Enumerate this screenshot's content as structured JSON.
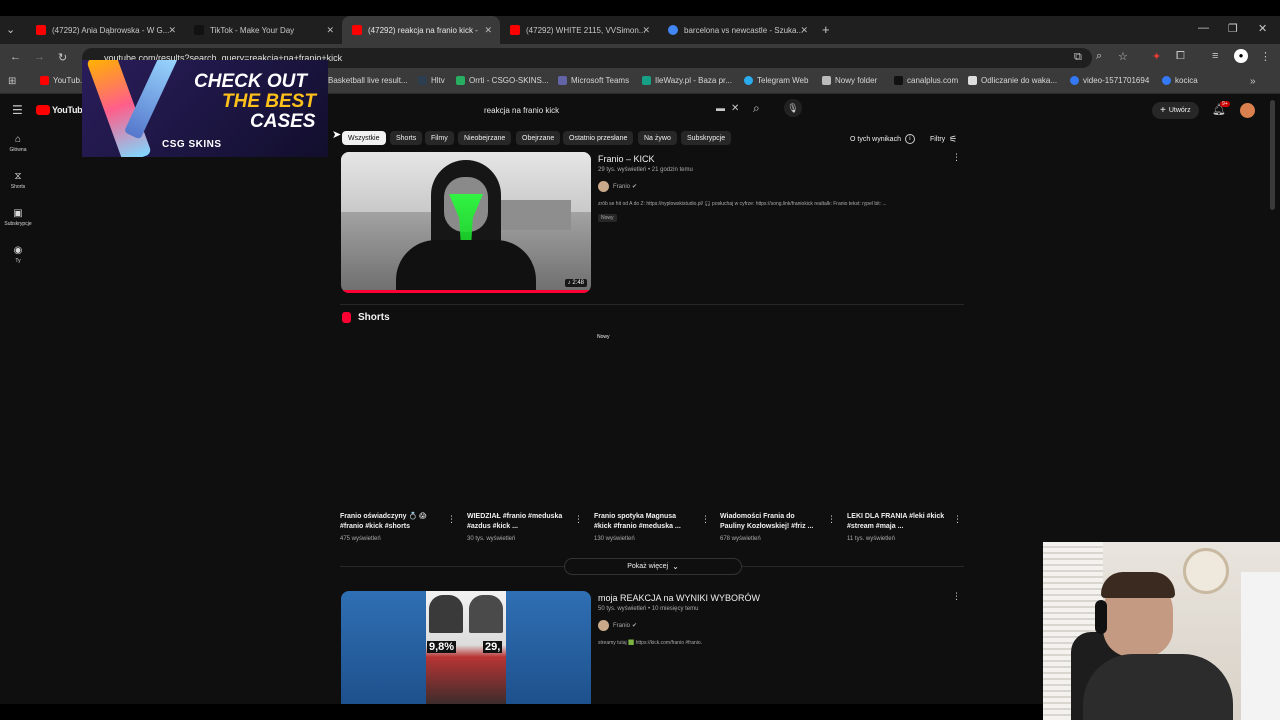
{
  "tabs": [
    {
      "label": "(47292) Ania Dąbrowska - W G...",
      "color": "#ff0000"
    },
    {
      "label": "TikTok - Make Your Day",
      "color": "#111111"
    },
    {
      "label": "(47292) reakcja na franio kick -",
      "color": "#ff0000"
    },
    {
      "label": "(47292) WHITE 2115, VVSimon...",
      "color": "#ff0000"
    },
    {
      "label": "barcelona vs newcastle - Szuka...",
      "color": "#4285f4"
    }
  ],
  "address": "youtube.com/results?search_query=reakcja+na+franio+kick",
  "bookmarks": [
    {
      "label": "YouTub...",
      "color": "#ff0000"
    },
    {
      "label": "Basketball live result...",
      "color": "#e67e22"
    },
    {
      "label": "Hltv",
      "color": "#2c3e50"
    },
    {
      "label": "Orrti - CSGO-SKINS...",
      "color": "#27ae60"
    },
    {
      "label": "Microsoft Teams",
      "color": "#6264a7"
    },
    {
      "label": "IleWazy.pl - Baza pr...",
      "color": "#16a085"
    },
    {
      "label": "Telegram Web",
      "color": "#2aabee"
    },
    {
      "label": "Nowy folder",
      "color": "#bbbbbb"
    },
    {
      "label": "canalplus.com",
      "color": "#111111"
    },
    {
      "label": "Odliczanie do waka...",
      "color": "#dddddd"
    },
    {
      "label": "video-1571701694",
      "color": "#3478f6"
    },
    {
      "label": "kocica",
      "color": "#3478f6"
    }
  ],
  "ad": {
    "line1": "CHECK OUT",
    "line2": "THE BEST",
    "line3": "CASES",
    "brand": "CSG SKINS"
  },
  "youtube": {
    "logo": "YouTube",
    "search_query": "reakcja na franio kick",
    "create_label": "Utwórz",
    "notif_count": "9+",
    "sidebar": [
      "Główna",
      "Shorts",
      "Subskrypcje",
      "Ty"
    ],
    "chips": [
      "Wszystkie",
      "Shorts",
      "Filmy",
      "Nieobejrzane",
      "Obejrzane",
      "Ostatnio przesłane",
      "Na żywo",
      "Subskrypcje"
    ],
    "about_results": "O tych wynikach",
    "filters": "Filtry",
    "video1": {
      "title": "Franio – KICK",
      "meta": "29 tys. wyświetleń • 21 godzin temu",
      "channel": "Franio",
      "desc": "zrób se hit od A do Z: https://nyplowskistudio.pl/ 🎧 posłuchaj w cyfrze: https://song.link/franiokick realtalk: Franio tekst: rypel bit: ...",
      "badge": "Nowy",
      "duration": "2:48"
    },
    "shorts_heading": "Shorts",
    "shorts_new": "Nowy",
    "shorts": [
      {
        "title": "Franio oświadczyny 💍 😱 #franio #kick #shorts",
        "views": "475 wyświetleń"
      },
      {
        "title": "WIEDZIAŁ #franio #meduska #azdus #kick ...",
        "views": "30 tys. wyświetleń"
      },
      {
        "title": "Franio spotyka Magnusa #kick #franio #meduska ...",
        "views": "130 wyświetleń"
      },
      {
        "title": "Wiadomości Frania do Pauliny Kozłowskiej! #friz ...",
        "views": "678 wyświetleń"
      },
      {
        "title": "LEKI DLA FRANIA #leki #kick #stream #maja ...",
        "views": "11 tys. wyświetleń"
      }
    ],
    "show_more": "Pokaż więcej",
    "video2": {
      "title": "moja REAKCJA na WYNIKI WYBORÓW",
      "meta": "50 tys. wyświetleń • 10 miesięcy temu",
      "channel": "Franio",
      "desc": "streamy tutaj 🟩 https://kick.com/franio #franio.",
      "pct_left": "9,8%",
      "pct_right": "29,"
    }
  }
}
